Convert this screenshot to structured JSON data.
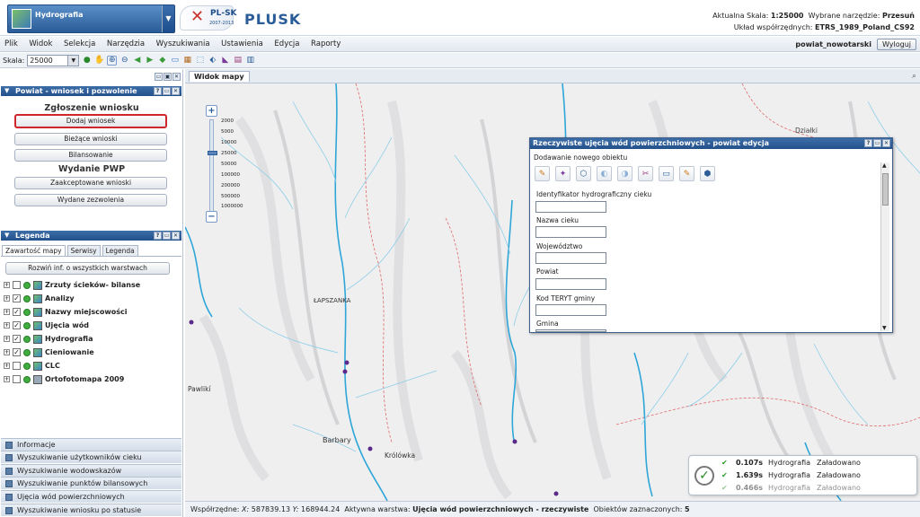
{
  "app": {
    "name": "Hydrografia",
    "logo_text": "PL-SK",
    "logo_years": "2007-2013",
    "brand": "PLUSK"
  },
  "header": {
    "scale_label": "Aktualna Skala:",
    "scale_value": "1:25000",
    "tool_label": "Wybrane narzędzie:",
    "tool_value": "Przesuń",
    "crs_label": "Układ współrzędnych:",
    "crs_value": "ETRS_1989_Poland_CS92",
    "user": "powiat_nowotarski",
    "logout_label": "Wyloguj"
  },
  "menu": [
    "Plik",
    "Widok",
    "Selekcja",
    "Narzędzia",
    "Wyszukiwania",
    "Ustawienia",
    "Edycja",
    "Raporty"
  ],
  "toolbar": {
    "scale_label": "Skala:",
    "scale_value": "25000"
  },
  "permits_panel": {
    "title": "Powiat - wniosek i pozwolenie",
    "section1": "Zgłoszenie wniosku",
    "buttons1": [
      "Dodaj wniosek",
      "Bieżące wnioski",
      "Bilansowanie"
    ],
    "section2": "Wydanie PWP",
    "buttons2": [
      "Zaakceptowane wnioski",
      "Wydane zezwolenia"
    ]
  },
  "legend_panel": {
    "title": "Legenda",
    "tabs": [
      "Zawartość mapy",
      "Serwisy",
      "Legenda"
    ],
    "expand_button": "Rozwiń inf. o wszystkich warstwach",
    "layers": [
      {
        "name": "Zrzuty ścieków- bilanse",
        "checked": false
      },
      {
        "name": "Analizy",
        "checked": true
      },
      {
        "name": "Nazwy miejscowości",
        "checked": true
      },
      {
        "name": "Ujęcia wód",
        "checked": true
      },
      {
        "name": "Hydrografia",
        "checked": true
      },
      {
        "name": "Cieniowanie",
        "checked": true
      },
      {
        "name": "CLC",
        "checked": false
      },
      {
        "name": "Ortofotomapa 2009",
        "checked": false
      }
    ]
  },
  "accordion": [
    "Informacje",
    "Wyszukiwanie użytkowników cieku",
    "Wyszukiwanie wodowskazów",
    "Wyszukiwanie punktów bilansowych",
    "Ujęcia wód powierzchniowych",
    "Wyszukiwanie wniosku po statusie"
  ],
  "map": {
    "tab_label": "Widok mapy",
    "place_labels": [
      "ŁAPSZANKA",
      "Pawlikí",
      "Barbary",
      "Królówka",
      "Działki"
    ],
    "scale_ticks": [
      "2000",
      "5000",
      "10000",
      "25000",
      "50000",
      "100000",
      "200000",
      "500000",
      "1000000"
    ]
  },
  "dialog": {
    "title": "Rzeczywiste ujęcia wód powierzchniowych - powiat edycja",
    "subtitle": "Dodawanie nowego obiektu",
    "fields": [
      "Identyfikator hydrograficzny cieku",
      "Nazwa cieku",
      "Województwo",
      "Powiat",
      "Kod TERYT gminy",
      "Gmina"
    ]
  },
  "notifications": [
    {
      "time": "0.107s",
      "layer": "Hydrografia",
      "status": "Załadowano"
    },
    {
      "time": "1.639s",
      "layer": "Hydrografia",
      "status": "Załadowano"
    },
    {
      "time": "0.466s",
      "layer": "Hydrografia",
      "status": "Załadowano"
    }
  ],
  "status": {
    "coord_label": "Współrzędne:",
    "x_label": "X:",
    "x_value": "587839.13",
    "y_label": "Y:",
    "y_value": "168944.24",
    "layer_label": "Aktywna warstwa:",
    "layer_value": "Ujęcia wód powierzchniowych - rzeczywiste",
    "selected_label": "Obiektów zaznaczonych:",
    "selected_value": "5"
  },
  "colors": {
    "accent": "#2a5c98",
    "highlight": "#d0262b",
    "river": "#2ea6d8"
  }
}
